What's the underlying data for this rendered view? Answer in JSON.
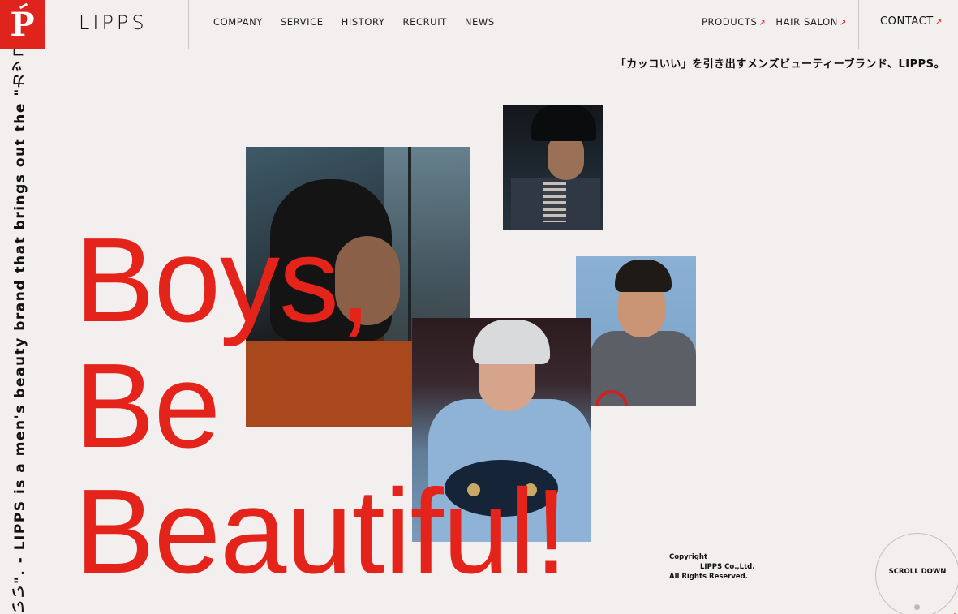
{
  "brand": {
    "logo_letter": "P",
    "name": "LIPPS",
    "accent_color": "#e0231d"
  },
  "nav": {
    "items": [
      "COMPANY",
      "SERVICE",
      "HISTORY",
      "RECRUIT",
      "NEWS"
    ]
  },
  "external_nav": {
    "items": [
      "PRODUCTS",
      "HAIR SALON"
    ],
    "arrow": "↗"
  },
  "contact": {
    "label": "CONTACT",
    "arrow": "↗"
  },
  "tagline": "「カッコいい」を引き出すメンズビューティーブランド、LIPPS。",
  "vertical_text": "いい\".   -   LIPPS is a men's beauty brand that brings out the \"カッコいい",
  "headline": {
    "line1": "Boys,",
    "line2": "Be",
    "line3": "Beautiful!",
    "color": "#e4231b"
  },
  "copyright": {
    "line1": "Copyright",
    "line2": "LIPPS Co.,Ltd.",
    "line3": "All Rights Reserved."
  },
  "scroll": {
    "label": "SCROLL DOWN"
  },
  "icons": [
    "arrow-up-right-icon"
  ]
}
